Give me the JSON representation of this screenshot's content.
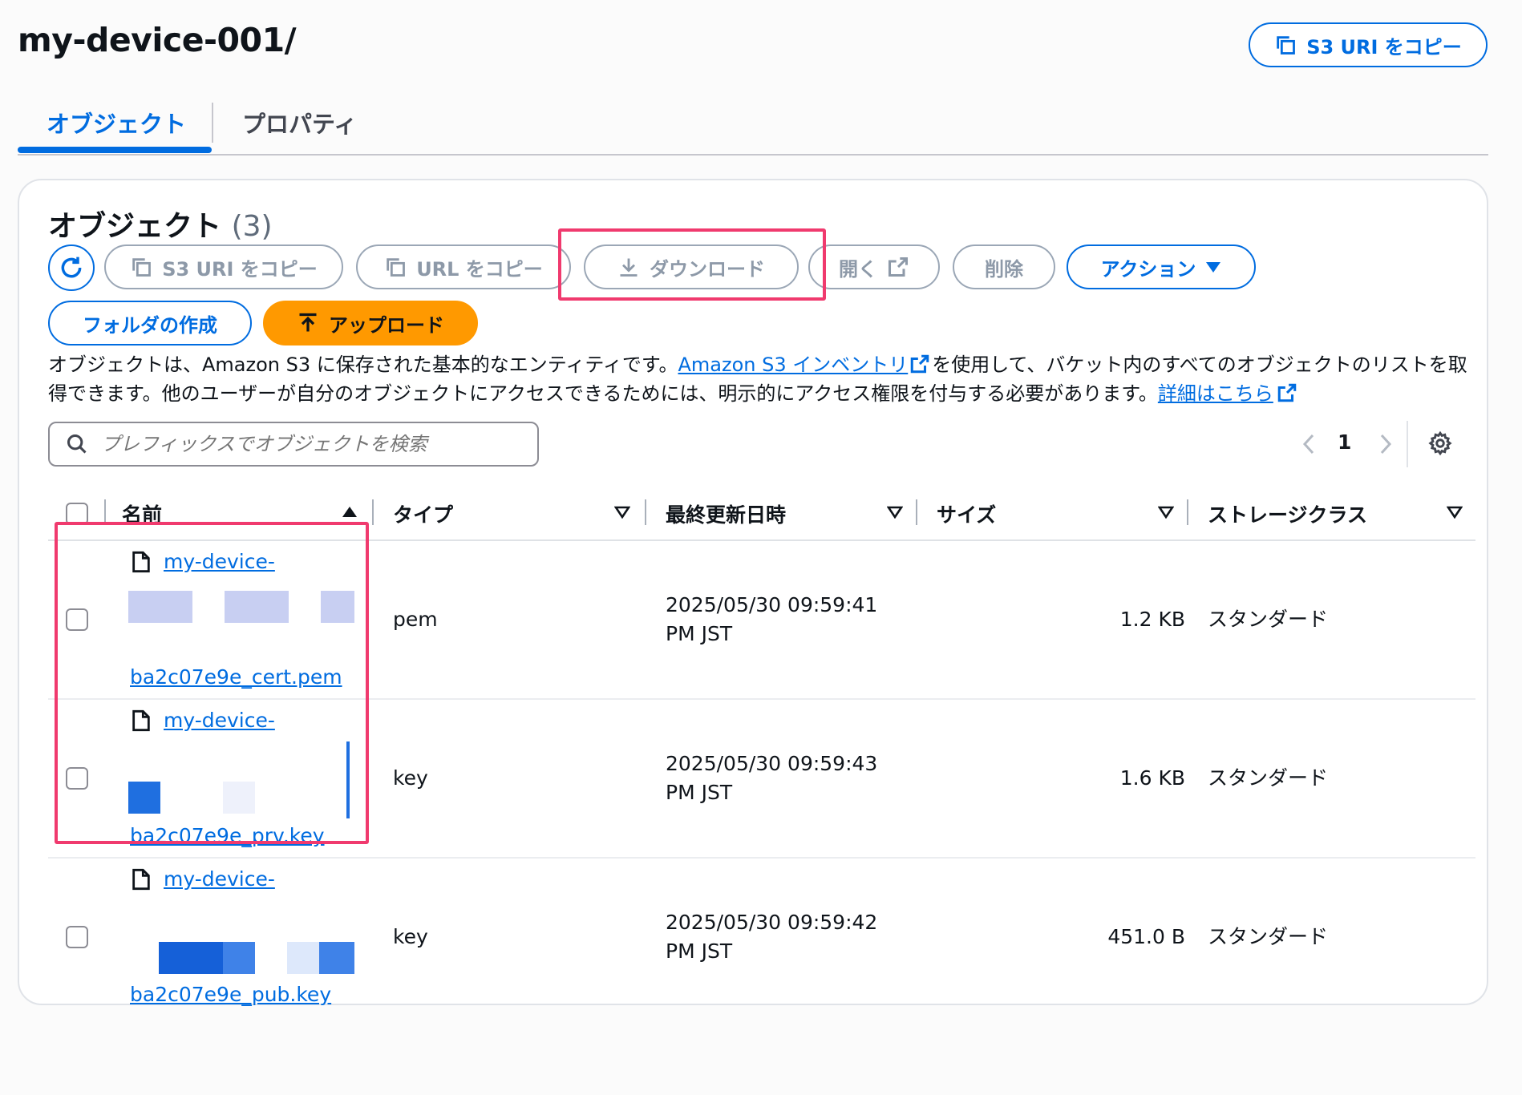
{
  "header": {
    "title": "my-device-001/",
    "copy_s3_uri": "S3 URI をコピー"
  },
  "tabs": [
    {
      "label": "オブジェクト",
      "active": true
    },
    {
      "label": "プロパティ",
      "active": false
    }
  ],
  "objects": {
    "title": "オブジェクト",
    "count": "(3)",
    "toolbar": {
      "copy_s3_uri": "S3 URI をコピー",
      "copy_url": "URL をコピー",
      "download": "ダウンロード",
      "open": "開く",
      "delete": "削除",
      "actions": "アクション",
      "create_folder": "フォルダの作成",
      "upload": "アップロード"
    },
    "description": {
      "part1": "オブジェクトは、Amazon S3 に保存された基本的なエンティティです。",
      "inventory_link": "Amazon S3 インベントリ",
      "part2": "を使用して、バケット内のすべてのオブジェクトのリストを取得できます。他のユーザーが自分のオブジェクトにアクセスできるためには、明示的にアクセス権限を付与する必要があります。",
      "details_link": "詳細はこちら"
    },
    "search_placeholder": "プレフィックスでオブジェクトを検索",
    "page": "1",
    "columns": {
      "name": "名前",
      "type": "タイプ",
      "last_modified": "最終更新日時",
      "size": "サイズ",
      "storage_class": "ストレージクラス"
    },
    "rows": [
      {
        "name_prefix": "my-device-",
        "name_suffix": "ba2c07e9e_cert.pem",
        "type": "pem",
        "date": "2025/05/30 09:59:41",
        "tz": "PM JST",
        "size": "1.2 KB",
        "storage": "スタンダード"
      },
      {
        "name_prefix": "my-device-",
        "name_suffix": "ba2c07e9e_prv.key",
        "type": "key",
        "date": "2025/05/30 09:59:43",
        "tz": "PM JST",
        "size": "1.6 KB",
        "storage": "スタンダード"
      },
      {
        "name_prefix": "my-device-",
        "name_suffix": "ba2c07e9e_pub.key",
        "type": "key",
        "date": "2025/05/30 09:59:42",
        "tz": "PM JST",
        "size": "451.0 B",
        "storage": "スタンダード"
      }
    ]
  },
  "colors": {
    "accent": "#006ce0",
    "upload": "#ff9900",
    "highlight": "#f03a6e",
    "disabled": "#8d99a8"
  },
  "icons": [
    "copy-icon",
    "refresh-icon",
    "download-icon",
    "external-link-icon",
    "caret-down-icon",
    "upload-icon",
    "search-icon",
    "chevron-left-icon",
    "chevron-right-icon",
    "gear-icon",
    "sort-ascending-icon",
    "sort-descending-icon",
    "file-icon"
  ]
}
